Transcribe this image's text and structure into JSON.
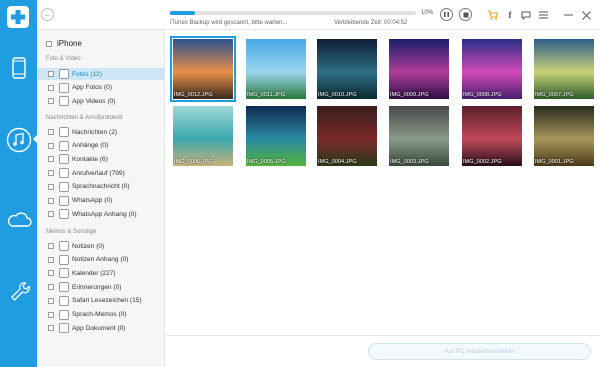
{
  "rail": {
    "items": [
      "device-icon",
      "music-icon",
      "cloud-icon",
      "tools-icon"
    ],
    "active": "music-icon",
    "color": "#1f9de0"
  },
  "topbar": {
    "status": "iTunes Backup wird gescannt, bitte warten...",
    "remaining": "Verbleibende Zeit: 00:04:52",
    "progress_percent": 10,
    "progress_label": "10%"
  },
  "tree": {
    "device": "iPhone",
    "sections": [
      {
        "title": "Foto & Video",
        "items": [
          {
            "label": "Fotos (12)",
            "icon": "photo-icon",
            "selected": true
          },
          {
            "label": "App Fotos (0)",
            "icon": "app-photo-icon",
            "selected": false
          },
          {
            "label": "App Videos (0)",
            "icon": "app-video-icon",
            "selected": false
          }
        ]
      },
      {
        "title": "Nachrichten & Anrufprotokoll",
        "items": [
          {
            "label": "Nachrichten (2)",
            "icon": "message-icon",
            "selected": false
          },
          {
            "label": "Anhänge (0)",
            "icon": "attachment-icon",
            "selected": false
          },
          {
            "label": "Kontakte (6)",
            "icon": "contacts-icon",
            "selected": false
          },
          {
            "label": "Anrufverlauf (799)",
            "icon": "phone-icon",
            "selected": false
          },
          {
            "label": "Sprachnachricht (0)",
            "icon": "voicemail-icon",
            "selected": false
          },
          {
            "label": "WhatsApp (0)",
            "icon": "whatsapp-icon",
            "selected": false
          },
          {
            "label": "WhatsApp Anhang (0)",
            "icon": "whatsapp-attachment-icon",
            "selected": false
          }
        ]
      },
      {
        "title": "Memos & Sonstige",
        "items": [
          {
            "label": "Notizen (0)",
            "icon": "notes-icon",
            "selected": false
          },
          {
            "label": "Notizen Anhang (0)",
            "icon": "notes-attachment-icon",
            "selected": false
          },
          {
            "label": "Kalender (227)",
            "icon": "calendar-icon",
            "selected": false
          },
          {
            "label": "Erinnerungen (0)",
            "icon": "reminder-icon",
            "selected": false
          },
          {
            "label": "Safari Lesezeichen (15)",
            "icon": "bookmark-icon",
            "selected": false
          },
          {
            "label": "Sprach-Memos (0)",
            "icon": "voice-memo-icon",
            "selected": false
          },
          {
            "label": "App Dokument (0)",
            "icon": "document-icon",
            "selected": false
          }
        ]
      }
    ]
  },
  "photos": [
    {
      "name": "IMG_0012.JPG",
      "colors": [
        "#2b4f8e",
        "#e9904a",
        "#3a2a1e"
      ],
      "selected": true
    },
    {
      "name": "IMG_0011.JPG",
      "colors": [
        "#49a8e6",
        "#9ad6ef",
        "#2c7a3a"
      ],
      "selected": false
    },
    {
      "name": "IMG_0010.JPG",
      "colors": [
        "#0d1d36",
        "#2f6f86",
        "#0a2a2f"
      ],
      "selected": false
    },
    {
      "name": "IMG_0009.JPG",
      "colors": [
        "#1a1e6b",
        "#b13d9c",
        "#2b0f43"
      ],
      "selected": false
    },
    {
      "name": "IMG_0008.JPG",
      "colors": [
        "#2a2f88",
        "#d14ab7",
        "#4a1f6f"
      ],
      "selected": false
    },
    {
      "name": "IMG_0007.JPG",
      "colors": [
        "#2d5d8a",
        "#c8d37a",
        "#2f5d2a"
      ],
      "selected": false
    },
    {
      "name": "IMG_0006.JPG",
      "colors": [
        "#9fd8d7",
        "#3aa7ae",
        "#c9b27a"
      ],
      "selected": false
    },
    {
      "name": "IMG_0005.JPG",
      "colors": [
        "#0e2a52",
        "#2a8aa3",
        "#56b23a"
      ],
      "selected": false
    },
    {
      "name": "IMG_0004.JPG",
      "colors": [
        "#3a1d1d",
        "#7a2a2a",
        "#2a3a1a"
      ],
      "selected": false
    },
    {
      "name": "IMG_0003.JPG",
      "colors": [
        "#4a4a4a",
        "#8a9a8a",
        "#3a4a3a"
      ],
      "selected": false
    },
    {
      "name": "IMG_0002.JPG",
      "colors": [
        "#5a1f2a",
        "#c04a5a",
        "#2a0f1a"
      ],
      "selected": false
    },
    {
      "name": "IMG_0001.JPG",
      "colors": [
        "#2a2a1e",
        "#a8975a",
        "#4a3a1a"
      ],
      "selected": false
    }
  ],
  "bottom": {
    "restore_label": "Auf PC wiederherstellen"
  }
}
